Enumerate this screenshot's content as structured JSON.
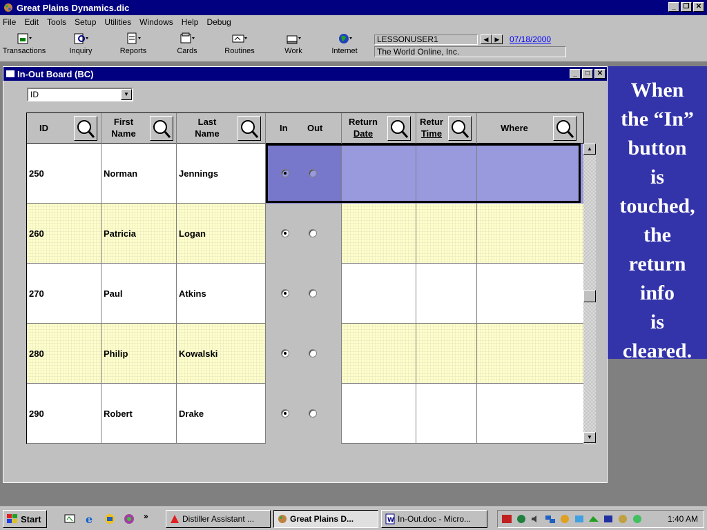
{
  "app": {
    "title": "Great Plains Dynamics.dic",
    "menu": [
      "File",
      "Edit",
      "Tools",
      "Setup",
      "Utilities",
      "Windows",
      "Help",
      "Debug"
    ],
    "toolbar": [
      "Transactions",
      "Inquiry",
      "Reports",
      "Cards",
      "Routines",
      "Work",
      "Internet"
    ],
    "user": "LESSONUSER1",
    "date": "07/18/2000",
    "company": "The World Online, Inc."
  },
  "window": {
    "title": "In-Out Board (BC)",
    "sort_select": "ID"
  },
  "grid": {
    "headers": {
      "id": "ID",
      "first_1": "First",
      "first_2": "Name",
      "last_1": "Last",
      "last_2": "Name",
      "in": "In",
      "out": "Out",
      "rdate_1": "Return",
      "rdate_2": "Date",
      "rtime_1": "Retur",
      "rtime_2": "Time",
      "where": "Where"
    },
    "rows": [
      {
        "id": "250",
        "first": "Norman",
        "last": "Jennings",
        "in": true
      },
      {
        "id": "260",
        "first": "Patricia",
        "last": "Logan",
        "in": true
      },
      {
        "id": "270",
        "first": "Paul",
        "last": "Atkins",
        "in": true
      },
      {
        "id": "280",
        "first": "Philip",
        "last": "Kowalski",
        "in": true
      },
      {
        "id": "290",
        "first": "Robert",
        "last": "Drake",
        "in": true
      }
    ]
  },
  "callout": {
    "lines": [
      "When",
      "the “In”",
      "button",
      "is",
      "touched,",
      "the",
      "return",
      "info",
      "is",
      "cleared."
    ]
  },
  "taskbar": {
    "start": "Start",
    "tasks": [
      "Distiller Assistant ...",
      "Great Plains D...",
      "In-Out.doc - Micro..."
    ],
    "clock": "1:40 AM"
  },
  "colors": {
    "title_bar": "#000080",
    "selection": "#9999dd",
    "callout_bg": "#3333aa",
    "row_alt": "#ffffcc"
  }
}
